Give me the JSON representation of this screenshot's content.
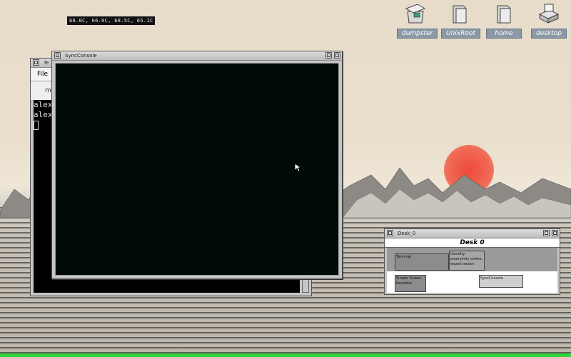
{
  "topbar": {
    "temps": "68.0C, 66.0C, 68.5C, 65.1C"
  },
  "desktop_icons": [
    {
      "label": "dumpster",
      "icon": "dumpster-icon"
    },
    {
      "label": "UnixRoot",
      "icon": "folder-icon"
    },
    {
      "label": "home",
      "icon": "folder-icon"
    },
    {
      "label": "desktop",
      "icon": "desktop-icon"
    }
  ],
  "terminal": {
    "title": "Te",
    "menu": [
      "File"
    ],
    "tab": "mo",
    "lines": [
      "alex",
      "alex"
    ]
  },
  "sync_console": {
    "title": "SyncConsole"
  },
  "pager": {
    "title": "Desk_0",
    "desk_name": "Desk 0",
    "windows": [
      "Terminal",
      "tionality anonymity online, export sesion",
      "Simple Screen Recorder",
      "SyncConsole"
    ]
  },
  "colors": {
    "terminal_bg": "#000000",
    "sync_bg": "#000b05",
    "icon_label_bg": "#8b98a6",
    "sun": "#ef4a3a"
  }
}
